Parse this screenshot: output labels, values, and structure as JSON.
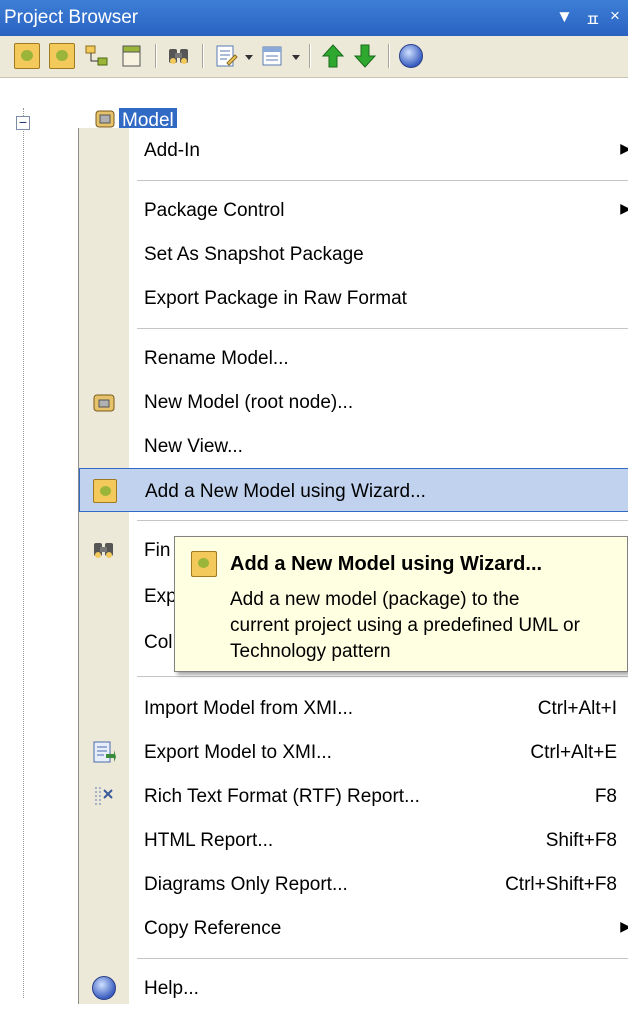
{
  "titlebar": {
    "title": "Project Browser",
    "dropdown": "▼",
    "pin": "ㅍ",
    "close": "×"
  },
  "tree": {
    "expander": "−",
    "model_label": "Model"
  },
  "menu": {
    "items": [
      {
        "label": "Add-In",
        "submenu": "▶"
      },
      {
        "label": "Package Control",
        "submenu": "▶"
      },
      {
        "label": "Set As Snapshot Package"
      },
      {
        "label": "Export Package in Raw Format"
      },
      {
        "label": "Rename Model..."
      },
      {
        "label": "New Model (root node)..."
      },
      {
        "label": "New View..."
      },
      {
        "label": "Add a New Model using Wizard..."
      },
      {
        "label": "Fin"
      },
      {
        "label": "Exp"
      },
      {
        "label": "Col"
      },
      {
        "label": "Import Model from XMI...",
        "shortcut": "Ctrl+Alt+I"
      },
      {
        "label": "Export Model to XMI...",
        "shortcut": "Ctrl+Alt+E"
      },
      {
        "label": "Rich Text Format (RTF) Report...",
        "shortcut": "F8"
      },
      {
        "label": "HTML Report...",
        "shortcut": "Shift+F8"
      },
      {
        "label": "Diagrams Only Report...",
        "shortcut": "Ctrl+Shift+F8"
      },
      {
        "label": "Copy Reference",
        "submenu": "▶"
      },
      {
        "label": "Help..."
      }
    ]
  },
  "tooltip": {
    "title": "Add a New Model using Wizard...",
    "lines": [
      "Add a new model (package) to the",
      "current project using a predefined UML or",
      "Technology pattern"
    ]
  },
  "colors": {
    "titlebar": "#2a62c2",
    "highlight": "#c1d2ee",
    "highlight_border": "#316ac5",
    "tooltip_bg": "#ffffe1",
    "gutter": "#ece9d8"
  }
}
